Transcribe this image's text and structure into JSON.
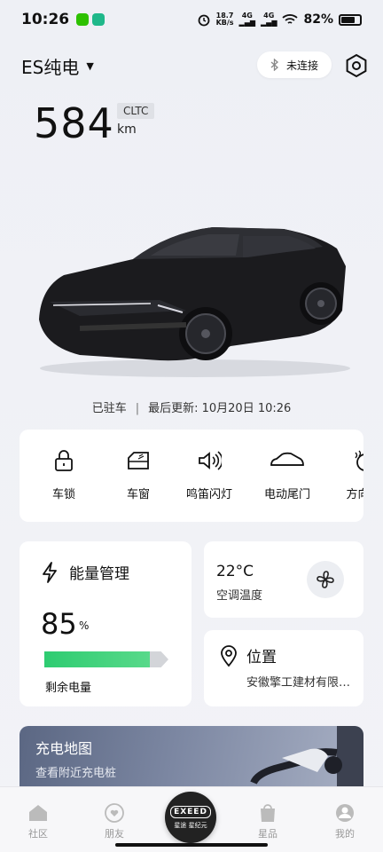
{
  "status_bar": {
    "time": "10:26",
    "speed": "18.7",
    "speed_unit": "KB/s",
    "net1": "4G",
    "net2": "4G",
    "battery": "82%"
  },
  "header": {
    "model": "ES纯电",
    "connection": "未连接"
  },
  "range": {
    "value": "584",
    "standard": "CLTC",
    "unit": "km"
  },
  "status": {
    "parked": "已驻车",
    "separator": "|",
    "updated": "最后更新: 10月20日 10:26"
  },
  "controls": [
    {
      "label": "车锁",
      "icon": "lock-icon"
    },
    {
      "label": "车窗",
      "icon": "window-icon"
    },
    {
      "label": "鸣笛闪灯",
      "icon": "horn-icon"
    },
    {
      "label": "电动尾门",
      "icon": "car-trunk-icon"
    },
    {
      "label": "方向盘",
      "icon": "steering-heat-icon"
    }
  ],
  "energy": {
    "title": "能量管理",
    "percent": "85",
    "unit": "%",
    "level": 0.85,
    "label": "剩余电量"
  },
  "climate": {
    "temp": "22",
    "temp_unit": "°C",
    "label": "空调温度"
  },
  "location": {
    "title": "位置",
    "address": "安徽擎工建材有限公司"
  },
  "charging": {
    "title": "充电地图",
    "subtitle": "查看附近充电桩"
  },
  "nav": [
    {
      "label": "社区",
      "icon": "community-icon"
    },
    {
      "label": "朋友",
      "icon": "friends-icon"
    },
    {
      "label": "星品",
      "icon": "shop-icon"
    },
    {
      "label": "我的",
      "icon": "profile-icon"
    }
  ],
  "nav_center": {
    "brand": "EXEED",
    "sub": "星途 星纪元"
  },
  "colors": {
    "accent_green": "#2ecc71",
    "card": "#ffffff",
    "background": "#eef0f5"
  }
}
